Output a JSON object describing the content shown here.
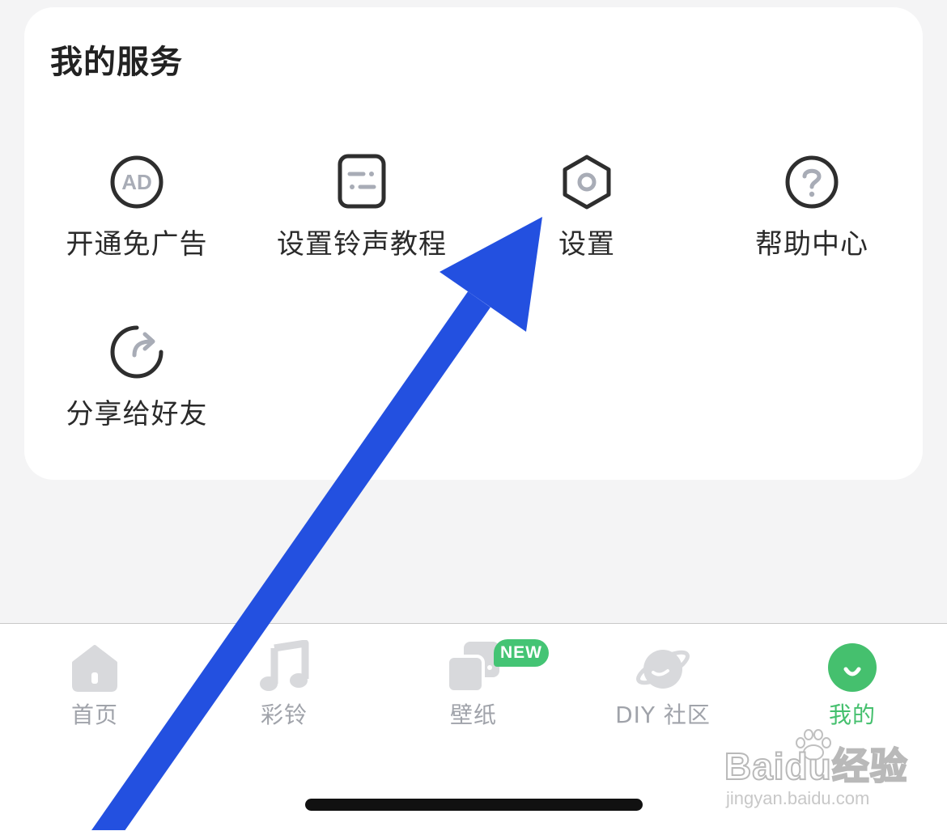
{
  "services": {
    "title": "我的服务",
    "items": [
      {
        "label": "开通免广告",
        "icon": "ad-icon"
      },
      {
        "label": "设置铃声教程",
        "icon": "tutorial-doc-icon"
      },
      {
        "label": "设置",
        "icon": "settings-hexagon-icon"
      },
      {
        "label": "帮助中心",
        "icon": "help-question-icon"
      },
      {
        "label": "分享给好友",
        "icon": "share-arrow-icon"
      }
    ]
  },
  "tabbar": {
    "tabs": [
      {
        "label": "首页",
        "icon": "home-icon",
        "active": false
      },
      {
        "label": "彩铃",
        "icon": "music-note-icon",
        "active": false
      },
      {
        "label": "壁纸",
        "icon": "wallpaper-icon",
        "active": false,
        "badge": "NEW"
      },
      {
        "label": "DIY 社区",
        "icon": "planet-icon",
        "active": false
      },
      {
        "label": "我的",
        "icon": "profile-smile-icon",
        "active": true
      }
    ]
  },
  "watermark": {
    "brand": "Baidu经验",
    "url": "jingyan.baidu.com"
  },
  "colors": {
    "active_tab": "#45c06e",
    "inactive_tab": "#a0a3aa",
    "annotation_arrow": "#2350e0",
    "badge": "#44c474"
  }
}
